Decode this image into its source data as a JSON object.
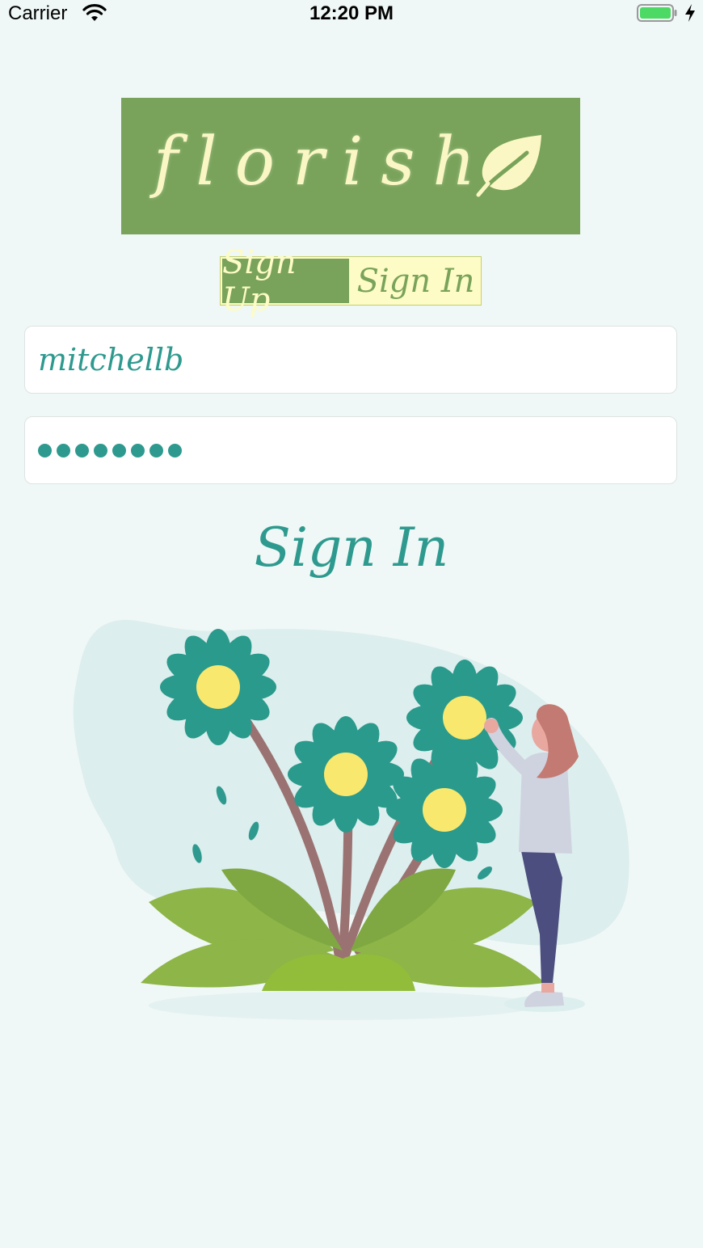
{
  "status_bar": {
    "carrier": "Carrier",
    "time": "12:20 PM",
    "icons": [
      "wifi-icon",
      "battery-icon",
      "charging-bolt-icon"
    ]
  },
  "logo": {
    "text": "florish",
    "icon": "leaf-icon",
    "background": "#79a35a",
    "text_color": "#fbf7c4"
  },
  "auth_toggle": {
    "options": [
      "Sign Up",
      "Sign In"
    ],
    "selected": "Sign Up"
  },
  "form": {
    "username_value": "mitchellb",
    "password_mask": "••••••••"
  },
  "submit": {
    "label": "Sign In"
  },
  "illustration": {
    "icon": "flowers-woman-illustration"
  },
  "colors": {
    "background": "#eff8f6",
    "accent_teal": "#2e9a8f",
    "accent_green": "#79a35a",
    "accent_cream": "#fdfbc6"
  }
}
